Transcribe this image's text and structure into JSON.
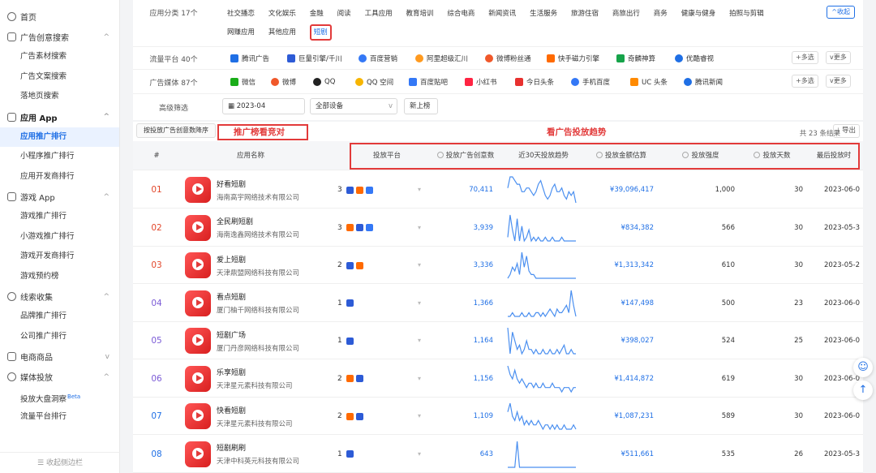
{
  "sidebar": {
    "home": "首页",
    "groups": [
      {
        "label": "广告创意搜索",
        "items": [
          "广告素材搜索",
          "广告文案搜索",
          "落地页搜索"
        ]
      },
      {
        "label": "应用 App",
        "items": [
          "应用推广排行",
          "小程序推广排行",
          "应用开发商排行"
        ]
      },
      {
        "label": "游戏 App",
        "items": [
          "游戏推广排行",
          "小游戏推广排行",
          "游戏开发商排行",
          "游戏预约榜"
        ]
      },
      {
        "label": "线索收集",
        "items": [
          "品牌推广排行",
          "公司推广排行"
        ]
      },
      {
        "label": "电商商品",
        "items": []
      },
      {
        "label": "媒体投放",
        "items": [
          "投放大盘洞察",
          "流量平台排行"
        ]
      }
    ],
    "beta": "Beta",
    "collapse": "收起侧边栏"
  },
  "filters": {
    "category_label": "应用分类 17个",
    "categories_row1": [
      "社交播恋",
      "文化娱乐",
      "金融",
      "阅读",
      "工具应用",
      "教育培训",
      "综合电商",
      "新闻资讯",
      "生活服务",
      "旅游住宿",
      "商旅出行",
      "商务",
      "健康与健身",
      "拍照与剪辑"
    ],
    "categories_row2": [
      "网赚应用",
      "其他应用",
      "短剧"
    ],
    "collapse_btn": "^收起",
    "traffic_label": "流量平台 40个",
    "traffic": [
      "腾讯广告",
      "巨量引擎/千川",
      "百度营销",
      "阿里超级汇川",
      "微博粉丝通",
      "快手磁力引擎",
      "奇麟神算",
      "优酷睿视"
    ],
    "media_label": "广告媒体 87个",
    "media": [
      "微信",
      "微博",
      "QQ",
      "QQ 空间",
      "百度贴吧",
      "小红书",
      "今日头条",
      "手机百度",
      "UC 头条",
      "腾讯新闻"
    ],
    "multi": "多选",
    "more": "更多",
    "advanced_label": "高级筛选",
    "month": "2023-04",
    "device": "全部设备",
    "new_list": "新上榜"
  },
  "toolbar": {
    "sort": "按投放广告创意数降序",
    "annotation_left": "推广榜看竞对",
    "annotation_right": "看广告投放趋势",
    "result_count": "共 23 条结果",
    "export": "导出"
  },
  "table": {
    "headers": {
      "rank": "#",
      "app": "应用名称",
      "platform": "投放平台",
      "creatives": "投放广告创意数",
      "trend": "近30天投放趋势",
      "amount": "投放金额估算",
      "intensity": "投放强度",
      "days": "投放天数",
      "last": "最后投放时"
    },
    "rows": [
      {
        "rank": "01",
        "name": "好看短剧",
        "company": "海南高宇网络技术有限公司",
        "platforms": 3,
        "creatives": "70,411",
        "amount": "¥39,096,417",
        "intensity": "1,000",
        "days": "30",
        "last": "2023-06-0",
        "trend": [
          6,
          9,
          9,
          8,
          7,
          7,
          5,
          5,
          6,
          6,
          5,
          4,
          5,
          7,
          8,
          6,
          4,
          3,
          4,
          6,
          7,
          5,
          5,
          6,
          4,
          3,
          5,
          4,
          5,
          2
        ]
      },
      {
        "rank": "02",
        "name": "全民刷短剧",
        "company": "海南逸鑫网络技术有限公司",
        "platforms": 3,
        "creatives": "3,939",
        "amount": "¥834,382",
        "intensity": "566",
        "days": "30",
        "last": "2023-05-3",
        "trend": [
          3,
          9,
          5,
          2,
          8,
          2,
          6,
          2,
          3,
          5,
          2,
          3,
          2,
          3,
          2,
          2,
          3,
          2,
          2,
          3,
          2,
          2,
          2,
          3,
          2,
          2,
          2,
          2,
          2,
          2
        ]
      },
      {
        "rank": "03",
        "name": "爱上短剧",
        "company": "天津鼎盟网络科技有限公司",
        "platforms": 2,
        "creatives": "3,336",
        "amount": "¥1,313,342",
        "intensity": "610",
        "days": "30",
        "last": "2023-05-2",
        "trend": [
          2,
          3,
          5,
          4,
          6,
          3,
          9,
          5,
          8,
          4,
          3,
          3,
          2,
          2,
          2,
          2,
          2,
          2,
          2,
          2,
          2,
          2,
          2,
          2,
          2,
          2,
          2,
          2,
          2,
          2
        ]
      },
      {
        "rank": "04",
        "name": "看点短剧",
        "company": "厦门柚千网络科技有限公司",
        "platforms": 1,
        "creatives": "1,366",
        "amount": "¥147,498",
        "intensity": "500",
        "days": "23",
        "last": "2023-06-0",
        "trend": [
          2,
          2,
          3,
          2,
          2,
          2,
          3,
          2,
          2,
          3,
          2,
          2,
          3,
          3,
          2,
          3,
          2,
          3,
          4,
          3,
          2,
          4,
          3,
          3,
          4,
          5,
          3,
          9,
          5,
          2
        ]
      },
      {
        "rank": "05",
        "name": "短剧广场",
        "company": "厦门丹彦网络科技有限公司",
        "platforms": 1,
        "creatives": "1,164",
        "amount": "¥398,027",
        "intensity": "524",
        "days": "25",
        "last": "2023-06-0",
        "trend": [
          8,
          2,
          7,
          5,
          3,
          4,
          2,
          3,
          5,
          3,
          3,
          2,
          3,
          2,
          2,
          3,
          2,
          2,
          3,
          2,
          2,
          3,
          2,
          3,
          4,
          2,
          2,
          3,
          2,
          2
        ]
      },
      {
        "rank": "06",
        "name": "乐享短剧",
        "company": "天津星元素科技有限公司",
        "platforms": 2,
        "creatives": "1,156",
        "amount": "¥1,414,872",
        "intensity": "619",
        "days": "30",
        "last": "2023-06-0",
        "trend": [
          8,
          6,
          5,
          7,
          5,
          4,
          5,
          4,
          3,
          4,
          4,
          3,
          4,
          3,
          3,
          4,
          3,
          3,
          3,
          4,
          3,
          3,
          3,
          2,
          3,
          3,
          3,
          2,
          3,
          3
        ]
      },
      {
        "rank": "07",
        "name": "快看短剧",
        "company": "天津星元素科技有限公司",
        "platforms": 2,
        "creatives": "1,109",
        "amount": "¥1,087,231",
        "intensity": "589",
        "days": "30",
        "last": "2023-06-0",
        "trend": [
          7,
          9,
          6,
          5,
          7,
          5,
          6,
          4,
          5,
          4,
          5,
          4,
          4,
          5,
          4,
          3,
          4,
          4,
          3,
          4,
          3,
          4,
          3,
          3,
          4,
          3,
          3,
          3,
          4,
          3
        ]
      },
      {
        "rank": "08",
        "name": "短剧刷刷",
        "company": "天津中科英元科技有限公司",
        "platforms": 1,
        "creatives": "643",
        "amount": "¥511,661",
        "intensity": "535",
        "days": "26",
        "last": "2023-05-3",
        "trend": [
          2,
          2,
          2,
          2,
          9,
          2,
          2,
          2,
          2,
          2,
          2,
          2,
          2,
          2,
          2,
          2,
          2,
          2,
          2,
          2,
          2,
          2,
          2,
          2,
          2,
          2,
          2,
          2,
          2,
          2
        ]
      }
    ]
  },
  "colors": {
    "accent": "#1f6fe5",
    "annotation": "#e23a3a",
    "rank_top": "#e2472b",
    "rank_mid": "#7b5bd6"
  }
}
